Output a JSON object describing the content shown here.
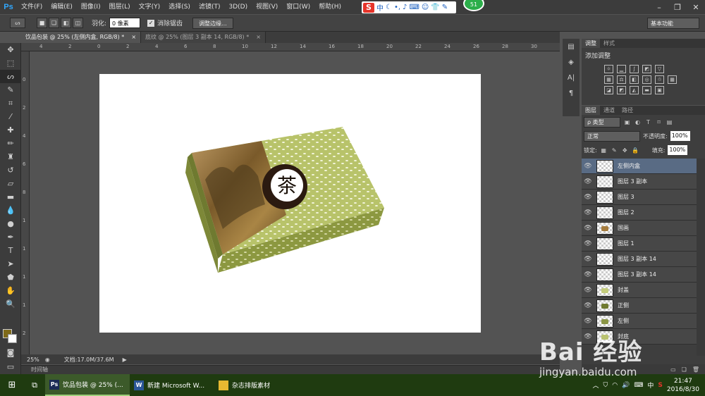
{
  "app": {
    "logo": "Ps"
  },
  "menu": [
    "文件(F)",
    "编辑(E)",
    "图像(I)",
    "图层(L)",
    "文字(Y)",
    "选择(S)",
    "滤镜(T)",
    "3D(D)",
    "视图(V)",
    "窗口(W)",
    "帮助(H)"
  ],
  "ime": {
    "logo": "S",
    "mode": "中"
  },
  "badge": "51",
  "options": {
    "feather_label": "羽化:",
    "feather_value": "0 像素",
    "antialias_label": "消除锯齿",
    "refine_edge": "调整边缘...",
    "workspace": "基本功能"
  },
  "tabs": [
    {
      "label": "饮品包装 @ 25% (左侧内盒, RGB/8) *",
      "close": "×"
    },
    {
      "label": "底纹 @ 25% (图层 3 副本 14, RGB/8) *",
      "close": "×"
    }
  ],
  "ruler": {
    "h": [
      "4",
      "2",
      "0",
      "2",
      "4",
      "6",
      "8",
      "10",
      "12",
      "14",
      "16",
      "18",
      "20",
      "22",
      "24",
      "26",
      "28",
      "30",
      "32"
    ],
    "v": [
      "0",
      "2",
      "4",
      "6",
      "8",
      "1",
      "1",
      "1",
      "1",
      "2"
    ]
  },
  "artwork": {
    "seal_char": "茶"
  },
  "status": {
    "zoom": "25%",
    "doc": "文档:17.0M/37.6M"
  },
  "timeline": "时间轴",
  "adjustments": {
    "tabs": [
      "调整",
      "样式"
    ],
    "title": "添加调整"
  },
  "layers_panel": {
    "tabs": [
      "图层",
      "通道",
      "路径"
    ],
    "filter": "ρ 类型",
    "blend": "正常",
    "opacity_label": "不透明度:",
    "opacity": "100%",
    "lock_label": "锁定:",
    "fill_label": "填充:",
    "fill": "100%",
    "layers": [
      {
        "name": "左侧内盒",
        "selected": true,
        "swatch": ""
      },
      {
        "name": "图层 3 副本",
        "selected": false,
        "swatch": ""
      },
      {
        "name": "图层 3",
        "selected": false,
        "swatch": ""
      },
      {
        "name": "图层 2",
        "selected": false,
        "swatch": ""
      },
      {
        "name": "国画",
        "selected": false,
        "swatch": "#a57c3e"
      },
      {
        "name": "图层 1",
        "selected": false,
        "swatch": ""
      },
      {
        "name": "图层 3 副本 14",
        "selected": false,
        "swatch": ""
      },
      {
        "name": "图层 3 副本 14",
        "selected": false,
        "swatch": ""
      },
      {
        "name": "封盖",
        "selected": false,
        "swatch": "#c4cc7c"
      },
      {
        "name": "正侧",
        "selected": false,
        "swatch": "#6f7a30"
      },
      {
        "name": "左侧",
        "selected": false,
        "swatch": "#8a9545"
      },
      {
        "name": "封底",
        "selected": false,
        "swatch": "#b9c270"
      }
    ]
  },
  "taskbar": {
    "tasks": [
      {
        "icon": "Ps",
        "label": "饮品包装 @ 25% (...",
        "color": "#1b2a55",
        "active": true
      },
      {
        "icon": "W",
        "label": "新建 Microsoft W...",
        "color": "#2b5797",
        "active": false
      },
      {
        "icon": "",
        "label": "杂志排版素材",
        "color": "#e7b931",
        "active": false
      }
    ],
    "tray_ime": "中",
    "time": "21:47",
    "date": "2016/8/30"
  },
  "watermark": {
    "brand": "Bai 经验",
    "url": "jingyan.baidu.com"
  }
}
